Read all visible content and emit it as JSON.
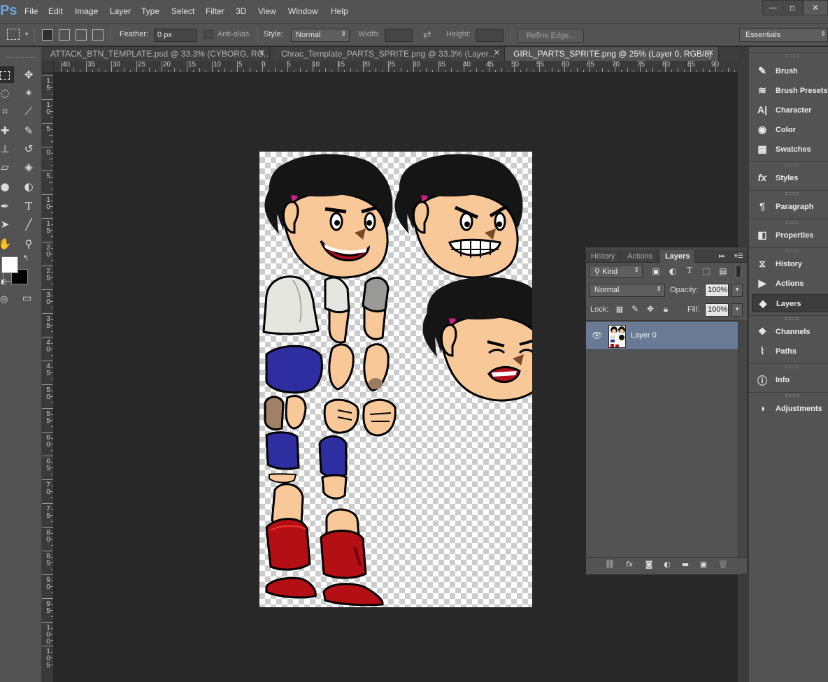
{
  "app": {
    "logo": "Ps"
  },
  "menu": [
    "File",
    "Edit",
    "Image",
    "Layer",
    "Type",
    "Select",
    "Filter",
    "3D",
    "View",
    "Window",
    "Help"
  ],
  "window_controls": {
    "minimize": "—",
    "restore": "▫",
    "close": "✕"
  },
  "options_bar": {
    "feather_label": "Feather:",
    "feather_value": "0 px",
    "antialias_label": "Anti-alias",
    "style_label": "Style:",
    "style_value": "Normal",
    "width_label": "Width:",
    "height_label": "Height:",
    "refine_edge_label": "Refine Edge..."
  },
  "workspace": "Essentials",
  "tabs": [
    {
      "label": "ATTACK_BTN_TEMPLATE.psd @ 33.3% (CYBORG, RG...",
      "active": false
    },
    {
      "label": "Chrac_Template_PARTS_SPRITE.png @ 33.3% (Layer...",
      "active": false
    },
    {
      "label": "GIRL_PARTS_SPRITE.png @ 25% (Layer 0, RGB/8)",
      "active": true
    }
  ],
  "ruler_h": [
    "40",
    "35",
    "30",
    "25",
    "20",
    "15",
    "10",
    "5",
    "0",
    "5",
    "10",
    "15",
    "20",
    "25",
    "30",
    "35",
    "40",
    "45",
    "50",
    "55",
    "60",
    "65",
    "70",
    "75",
    "80",
    "85",
    "90"
  ],
  "ruler_v": [
    "1\n5",
    "1\n0",
    "5",
    "0",
    "5",
    "1\n0",
    "1\n5",
    "2\n0",
    "2\n5",
    "3\n0",
    "3\n5",
    "4\n0",
    "4\n5",
    "5\n0",
    "5\n5",
    "6\n0",
    "6\n5",
    "7\n0",
    "7\n5",
    "8\n0",
    "8\n5",
    "9\n0",
    "9\n5",
    "1\n0\n0",
    "1\n0\n5"
  ],
  "dock": {
    "items": [
      {
        "label": "Brush",
        "icon": "brush-icon"
      },
      {
        "label": "Brush Presets",
        "icon": "brush-presets-icon"
      },
      {
        "label": "Character",
        "icon": "character-icon"
      },
      {
        "label": "Color",
        "icon": "color-icon"
      },
      {
        "label": "Swatches",
        "icon": "swatches-icon"
      },
      {
        "label": "Styles",
        "icon": "styles-icon"
      },
      {
        "label": "Paragraph",
        "icon": "paragraph-icon"
      },
      {
        "label": "Properties",
        "icon": "properties-icon"
      },
      {
        "label": "History",
        "icon": "history-icon"
      },
      {
        "label": "Actions",
        "icon": "actions-icon"
      },
      {
        "label": "Layers",
        "icon": "layers-icon"
      },
      {
        "label": "Channels",
        "icon": "channels-icon"
      },
      {
        "label": "Paths",
        "icon": "paths-icon"
      },
      {
        "label": "Info",
        "icon": "info-icon"
      },
      {
        "label": "Adjustments",
        "icon": "adjustments-icon"
      }
    ]
  },
  "layers_panel": {
    "tabs": [
      "History",
      "Actions",
      "Layers"
    ],
    "active_tab": "Layers",
    "kind_label": "Kind",
    "blend_mode": "Normal",
    "opacity_label": "Opacity:",
    "opacity_value": "100%",
    "lock_label": "Lock:",
    "fill_label": "Fill:",
    "fill_value": "100%",
    "layers": [
      {
        "name": "Layer 0",
        "visible": true,
        "selected": true
      }
    ]
  },
  "colors": {
    "foreground": "#ffffff",
    "background": "#000000",
    "selection": "#6a7a94",
    "hair": "#151515",
    "skin": "#f9c899",
    "shirt": "#e6e6e0",
    "shorts": "#2e2ea0",
    "boots": "#b30f14"
  }
}
